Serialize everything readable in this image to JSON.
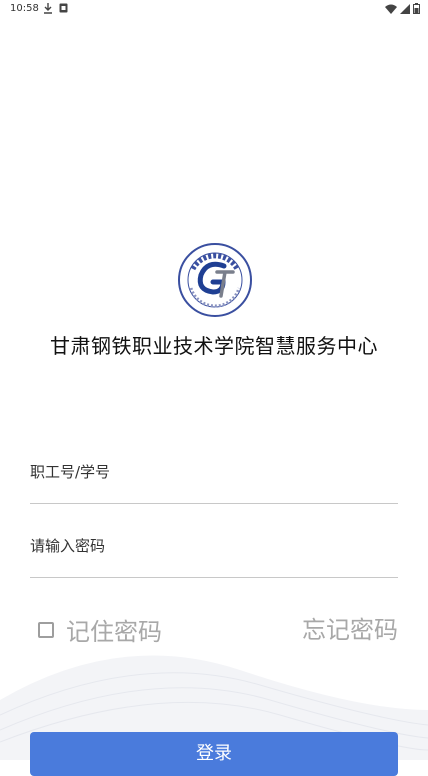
{
  "status_bar": {
    "time": "10:58",
    "icons": [
      "download-icon",
      "sim-icon",
      "wifi-icon",
      "signal-icon",
      "battery-icon"
    ]
  },
  "app": {
    "title": "甘肃钢铁职业技术学院智慧服务中心",
    "logo": {
      "icon": "college-seal-logo",
      "accent": "#1f3f93",
      "ring": "#3a4fa0"
    }
  },
  "form": {
    "username_placeholder": "职工号/学号",
    "password_placeholder": "请输入密码",
    "remember_label": "记住密码",
    "remember_checked": false,
    "forgot_label": "忘记密码",
    "login_label": "登录"
  },
  "colors": {
    "primary": "#4a7bdc",
    "muted_text": "#a8a8a8",
    "divider": "#c8c8c8"
  }
}
